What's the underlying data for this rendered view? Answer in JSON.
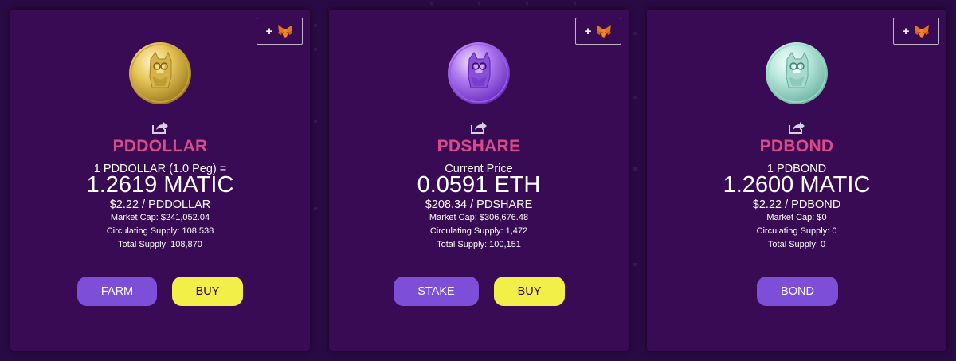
{
  "colors": {
    "background": "#2a0a44",
    "card": "#3a0b55",
    "token_name": "#d84a8a",
    "primary_button": "#7d4fd9",
    "buy_button": "#f1ef48"
  },
  "add_button_label": "+",
  "cards": [
    {
      "token": "PDDOLLAR",
      "coin_icon": "gold-dog-coin",
      "price_label": "1 PDDOLLAR (1.0 Peg) =",
      "price": "1.2619 MATIC",
      "usd_price": "$2.22 / PDDOLLAR",
      "market_cap": "Market Cap: $241,052.04",
      "circulating_supply": "Circulating Supply: 108,538",
      "total_supply": "Total Supply: 108,870",
      "buttons": [
        "FARM",
        "BUY"
      ]
    },
    {
      "token": "PDSHARE",
      "coin_icon": "purple-dog-coin",
      "price_label": "Current Price",
      "price": "0.0591 ETH",
      "usd_price": "$208.34 / PDSHARE",
      "market_cap": "Market Cap: $306,676.48",
      "circulating_supply": "Circulating Supply: 1,472",
      "total_supply": "Total Supply: 100,151",
      "buttons": [
        "STAKE",
        "BUY"
      ]
    },
    {
      "token": "PDBOND",
      "coin_icon": "teal-dog-coin",
      "price_label": "1 PDBOND",
      "price": "1.2600 MATIC",
      "usd_price": "$2.22 / PDBOND",
      "market_cap": "Market Cap: $0",
      "circulating_supply": "Circulating Supply: 0",
      "total_supply": "Total Supply: 0",
      "buttons": [
        "BOND"
      ]
    }
  ]
}
